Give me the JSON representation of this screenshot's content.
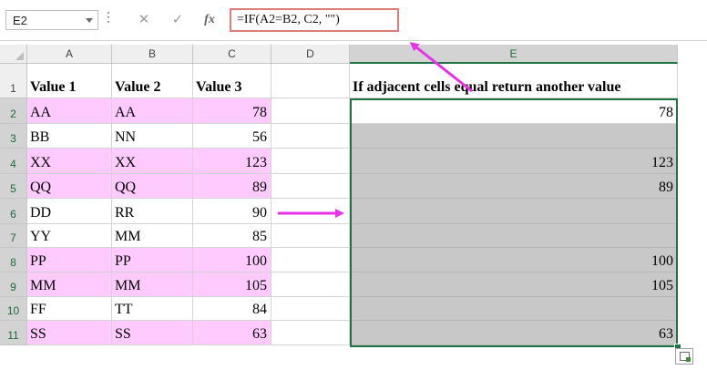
{
  "name_box": "E2",
  "formula": "=IF(A2=B2, C2, \"\")",
  "formula_buttons": {
    "cancel": "✕",
    "enter": "✓",
    "fx": "fx"
  },
  "columns": [
    "A",
    "B",
    "C",
    "D",
    "E"
  ],
  "rows": [
    "1",
    "2",
    "3",
    "4",
    "5",
    "6",
    "7",
    "8",
    "9",
    "10",
    "11"
  ],
  "headers": {
    "a": "Value 1",
    "b": "Value 2",
    "c": "Value 3",
    "e": "If adjacent cells equal return another value"
  },
  "data": [
    {
      "a": "AA",
      "b": "AA",
      "c": "78",
      "e": "78",
      "pink": true
    },
    {
      "a": "BB",
      "b": "NN",
      "c": "56",
      "e": "",
      "pink": false
    },
    {
      "a": "XX",
      "b": "XX",
      "c": "123",
      "e": "123",
      "pink": true
    },
    {
      "a": "QQ",
      "b": "QQ",
      "c": "89",
      "e": "89",
      "pink": true
    },
    {
      "a": "DD",
      "b": "RR",
      "c": "90",
      "e": "",
      "pink": false
    },
    {
      "a": "YY",
      "b": "MM",
      "c": "85",
      "e": "",
      "pink": false
    },
    {
      "a": "PP",
      "b": "PP",
      "c": "100",
      "e": "100",
      "pink": true
    },
    {
      "a": "MM",
      "b": "MM",
      "c": "105",
      "e": "105",
      "pink": true
    },
    {
      "a": "FF",
      "b": "TT",
      "c": "84",
      "e": "",
      "pink": false
    },
    {
      "a": "SS",
      "b": "SS",
      "c": "63",
      "e": "63",
      "pink": true
    }
  ],
  "colors": {
    "match_highlight": "#ffcbff",
    "result_fill": "#c8c8c8",
    "selection": "#217346",
    "arrow": "#e832e8",
    "formula_border": "#e07b77"
  }
}
